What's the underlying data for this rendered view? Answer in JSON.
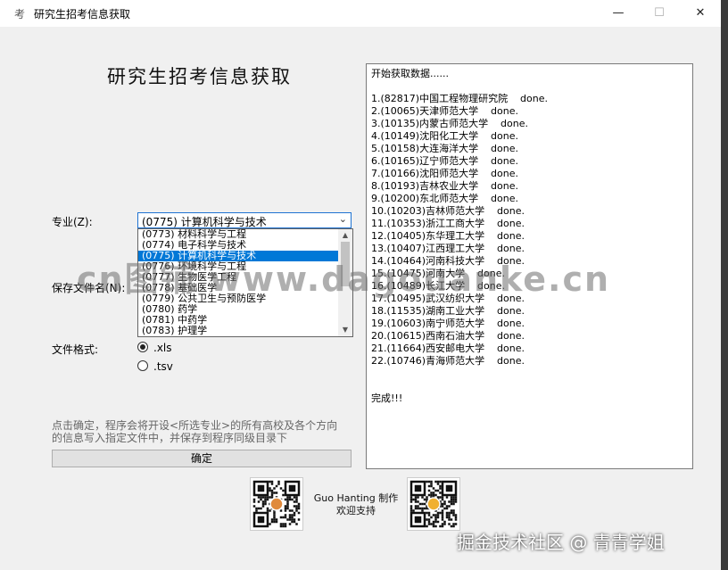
{
  "window": {
    "title": "研究生招考信息获取",
    "app_icon": "考",
    "controls": {
      "minimize": "—",
      "maximize": "☐",
      "close": "✕"
    }
  },
  "heading": "研究生招考信息获取",
  "major": {
    "label": "专业(Z):",
    "selected": "(0775) 计算机科学与技术",
    "options": [
      "(0773) 材料科学与工程",
      "(0774) 电子科学与技术",
      "(0775) 计算机科学与技术",
      "(0776) 环境科学与工程",
      "(0777) 生物医学工程",
      "(0778) 基础医学",
      "(0779) 公共卫生与预防医学",
      "(0780) 药学",
      "(0781) 中药学",
      "(0783) 护理学"
    ]
  },
  "save_file_label": "保存文件名(N):",
  "file_format": {
    "label": "文件格式:",
    "options": [
      {
        "label": ".xls",
        "checked": true
      },
      {
        "label": ".tsv",
        "checked": false
      }
    ]
  },
  "description": "点击确定，程序会将开设<所选专业>的所有高校及各个方向的信息写入指定文件中，并保存到程序同级目录下",
  "confirm_button": "确定",
  "log": {
    "header": "开始获取数据......",
    "entries": [
      "1.(82817)中国工程物理研究院    done.",
      "2.(10065)天津师范大学    done.",
      "3.(10135)内蒙古师范大学    done.",
      "4.(10149)沈阳化工大学    done.",
      "5.(10158)大连海洋大学    done.",
      "6.(10165)辽宁师范大学    done.",
      "7.(10166)沈阳师范大学    done.",
      "8.(10193)吉林农业大学    done.",
      "9.(10200)东北师范大学    done.",
      "10.(10203)吉林师范大学    done.",
      "11.(10353)浙江工商大学    done.",
      "12.(10405)东华理工大学    done.",
      "13.(10407)江西理工大学    done.",
      "14.(10464)河南科技大学    done.",
      "15.(10475)河南大学    done.",
      "16.(10489)长江大学    done.",
      "17.(10495)武汉纺织大学    done.",
      "18.(11535)湖南工业大学    done.",
      "19.(10603)南宁师范大学    done.",
      "20.(10615)西南石油大学    done.",
      "21.(11664)西安邮电大学    done.",
      "22.(10746)青海师范大学    done."
    ],
    "footer": "完成!!!"
  },
  "credit": {
    "author": "Guo Hanting 制作",
    "thanks": "欢迎支持"
  },
  "watermarks": {
    "center": "cn图铺 www.dagouanke.cn",
    "corner": "掘金技术社区 @ 青青学姐"
  },
  "icons": {
    "chevron": "chevron-down-icon",
    "qr": "qr-code-icon"
  },
  "colors": {
    "selection": "#0078d7",
    "window_bg": "#f0f0f0",
    "focus_border": "#1e73d2"
  }
}
